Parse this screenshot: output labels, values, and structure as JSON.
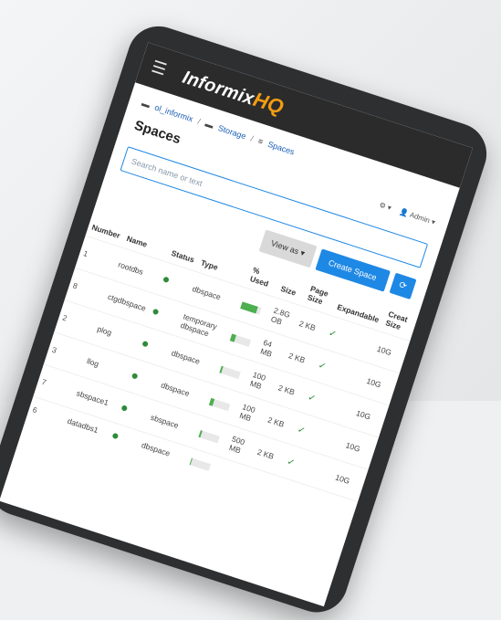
{
  "app": {
    "brand_main": "Informix",
    "brand_hq": "HQ"
  },
  "breadcrumb": [
    "ol_informix",
    "Storage",
    "Spaces"
  ],
  "page": {
    "title": "Spaces",
    "top_actions": [
      "⚙ ▾",
      "👤 Admin ▾"
    ]
  },
  "search": {
    "placeholder": "Search name or text"
  },
  "toolbar": {
    "view_as": "View as ▾",
    "create": "Create Space",
    "refresh": "⟳"
  },
  "table": {
    "headers": [
      "Number",
      "Name",
      "Status",
      "Type",
      "% Used",
      "Size",
      "Page Size",
      "Expandable",
      "Creat Size"
    ],
    "rows": [
      {
        "number": "1",
        "name": "rootdbs",
        "type": "dbspace",
        "used_pct": 80,
        "size": "2.8G\nOB",
        "page": "2 KB",
        "exp": "✓",
        "creat": "10G"
      },
      {
        "number": "8",
        "name": "ctgdbspace",
        "type": "temporary\ndbspace",
        "used_pct": 20,
        "size": "64\nMB",
        "page": "2 KB",
        "exp": "✓",
        "creat": "10G"
      },
      {
        "number": "2",
        "name": "plog",
        "type": "dbspace",
        "used_pct": 10,
        "size": "100\nMB",
        "page": "2 KB",
        "exp": "✓",
        "creat": "10G"
      },
      {
        "number": "3",
        "name": "llog",
        "type": "dbspace",
        "used_pct": 15,
        "size": "100\nMB",
        "page": "2 KB",
        "exp": "✓",
        "creat": "10G"
      },
      {
        "number": "7",
        "name": "sbspace1",
        "type": "sbspace",
        "used_pct": 10,
        "size": "500\nMB",
        "page": "2 KB",
        "exp": "✓",
        "creat": "10G"
      },
      {
        "number": "6",
        "name": "datadbs1",
        "type": "dbspace",
        "used_pct": 5,
        "size": "",
        "page": "",
        "exp": "",
        "creat": ""
      }
    ]
  },
  "colors": {
    "accent": "#1e88e5",
    "brand_hq": "#f39c12",
    "status_online": "#2e8b3a"
  }
}
